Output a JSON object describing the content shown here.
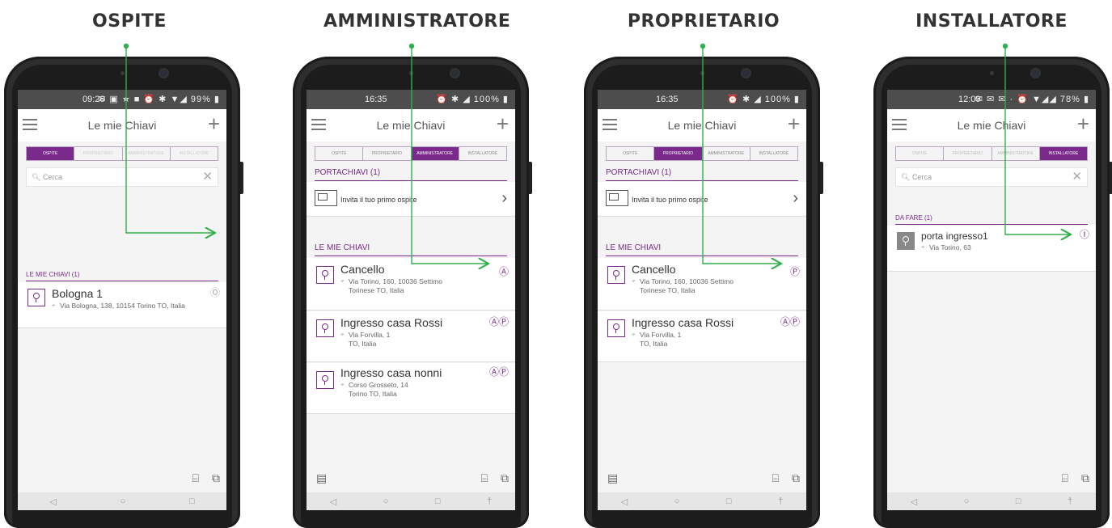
{
  "roles": [
    "OSPITE",
    "AMMINISTRATORE",
    "PROPRIETARIO",
    "INSTALLATORE"
  ],
  "colors": {
    "accent": "#7a2a8a",
    "callout": "#2fb04a"
  },
  "phones": [
    {
      "status": {
        "time": "09:26",
        "icons": "✉ ▣ ★ ■ ⏰ ✱ ▼◢ 99% ▮"
      },
      "title": "Le mie Chiavi",
      "tabs": [
        "OSPITE",
        "PROPRIETARIO",
        "AMMINISTRATORE",
        "INSTALLATORE"
      ],
      "search": "Cerca",
      "section": "LE MIE CHIAVI (1)",
      "items": [
        {
          "title": "Bologna 1",
          "address": "Via Bologna, 138, 10154 Torino TO, Italia",
          "badge": "Ⓞ"
        }
      ]
    },
    {
      "status": {
        "time": "16:35",
        "icons": "⏰ ✱ ◢ 100% ▮"
      },
      "title": "Le mie Chiavi",
      "tabs": [
        "OSPITE",
        "PROPRIETARIO",
        "AMMINISTRATORE",
        "INSTALLATORE"
      ],
      "section1": "PORTACHIAVI (1)",
      "invite": "Invita il tuo primo ospite",
      "section2": "LE MIE CHIAVI",
      "items": [
        {
          "title": "Cancello",
          "address1": "Via Torino, 160, 10036 Settimo",
          "address2": "Torinese TO, Italia",
          "badge": "Ⓐ"
        },
        {
          "title": "Ingresso casa Rossi",
          "address1": "Via Forvilla, 1",
          "address2": "TO, Italia",
          "badge": "ⒶⓅ"
        },
        {
          "title": "Ingresso casa nonni",
          "address1": "Corso Grosseto, 14",
          "address2": "Torino TO, Italia",
          "badge": "ⒶⓅ"
        }
      ]
    },
    {
      "status": {
        "time": "16:35",
        "icons": "⏰ ✱ ◢ 100% ▮"
      },
      "title": "Le mie Chiavi",
      "tabs": [
        "OSPITE",
        "PROPRIETARIO",
        "AMMINISTRATORE",
        "INSTALLATORE"
      ],
      "section1": "PORTACHIAVI (1)",
      "invite": "Invita il tuo primo ospite",
      "section2": "LE MIE CHIAVI",
      "items": [
        {
          "title": "Cancello",
          "address1": "Via Torino, 160, 10036 Settimo",
          "address2": "Torinese TO, Italia",
          "badge": "Ⓟ"
        },
        {
          "title": "Ingresso casa Rossi",
          "address1": "Via Forvilla, 1",
          "address2": "TO, Italia",
          "badge": "ⒶⓅ"
        }
      ]
    },
    {
      "status": {
        "time": "12:09",
        "icons": "✉ ✉ ✉ ·  ⏰ ▼◢◢ 78% ▮"
      },
      "title": "Le mie Chiavi",
      "tabs": [
        "OSPITE",
        "PROPRIETARIO",
        "AMMINISTRATORE",
        "INSTALLATORE"
      ],
      "search": "Cerca",
      "section": "DA FARE (1)",
      "items": [
        {
          "title": "porta ingresso1",
          "address": "Via Torino, 63",
          "badge": "Ⓘ"
        }
      ]
    }
  ],
  "navbar": {
    "back": "◁",
    "home": "○",
    "recent": "□",
    "extra": "†"
  },
  "tools": {
    "scan": "⌸",
    "cards": "⧉",
    "contacts": "▤"
  }
}
